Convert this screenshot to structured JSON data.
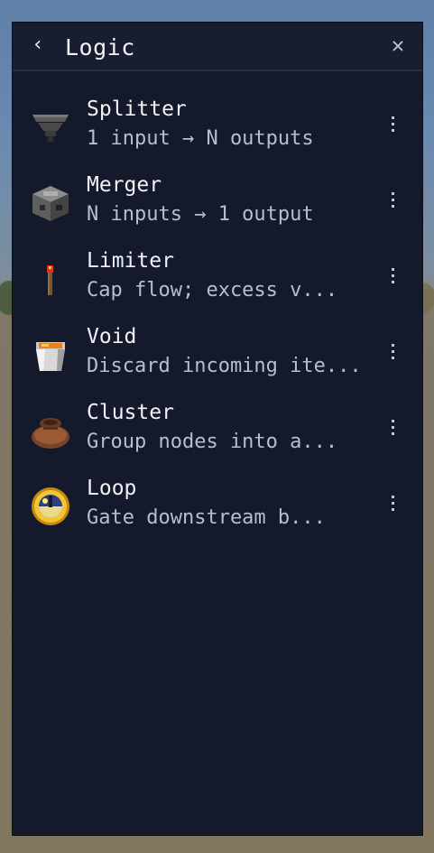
{
  "header": {
    "back_icon": "‹",
    "title": "Logic",
    "close_icon": "✕"
  },
  "items": [
    {
      "name": "Splitter",
      "description": "1 input → N outputs",
      "icon": "hopper-funnel-icon"
    },
    {
      "name": "Merger",
      "description": "N inputs → 1 output",
      "icon": "dropper-block-icon"
    },
    {
      "name": "Limiter",
      "description": "Cap flow; excess v...",
      "icon": "redstone-torch-icon"
    },
    {
      "name": "Void",
      "description": "Discard incoming ite...",
      "icon": "lava-bucket-icon"
    },
    {
      "name": "Cluster",
      "description": "Group nodes into a...",
      "icon": "bundle-icon"
    },
    {
      "name": "Loop",
      "description": "Gate downstream b...",
      "icon": "clock-icon"
    }
  ],
  "colors": {
    "panel_bg": "#14192b",
    "header_bg": "#181d30",
    "text_primary": "#f1f2f6",
    "text_secondary": "#b9bdcc"
  }
}
